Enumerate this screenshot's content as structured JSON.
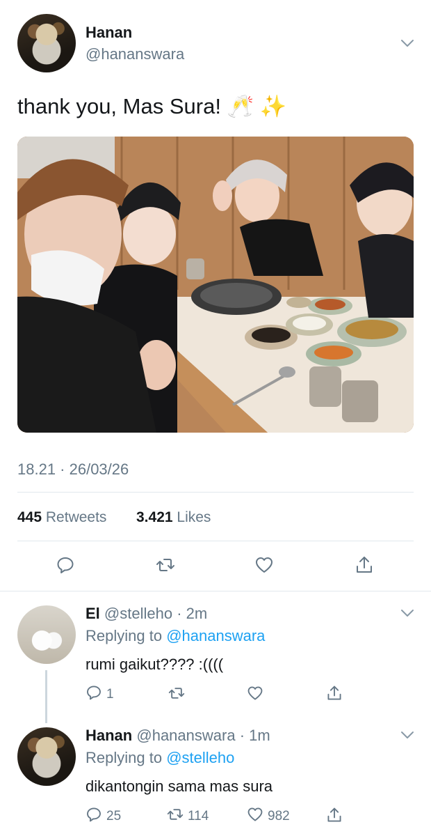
{
  "tweet": {
    "author_name": "Hanan",
    "author_handle": "@hananswara",
    "text": "thank you, Mas Sura! 🥂 ✨",
    "timestamp": "18.21 · 26/03/26",
    "retweets_count": "445",
    "retweets_label": "Retweets",
    "likes_count": "3.421",
    "likes_label": "Likes"
  },
  "actions": {
    "reply_icon": "reply-icon",
    "retweet_icon": "retweet-icon",
    "like_icon": "heart-icon",
    "share_icon": "share-icon"
  },
  "replies": [
    {
      "name": "El",
      "handle": "@stelleho",
      "time": "· 2m",
      "replying_prefix": "Replying to",
      "replying_to": "@hananswara",
      "text": "rumi gaikut???? :((((",
      "reply_count": "1",
      "retweet_count": "",
      "like_count": ""
    },
    {
      "name": "Hanan",
      "handle": "@hananswara",
      "time": "· 1m",
      "replying_prefix": "Replying to",
      "replying_to": "@stelleho",
      "text": "dikantongin sama mas sura",
      "reply_count": "25",
      "retweet_count": "114",
      "like_count": "982"
    }
  ],
  "colors": {
    "accent": "#1da1f2",
    "muted": "#657786",
    "text": "#14171a",
    "divider": "#e1e8ed"
  }
}
